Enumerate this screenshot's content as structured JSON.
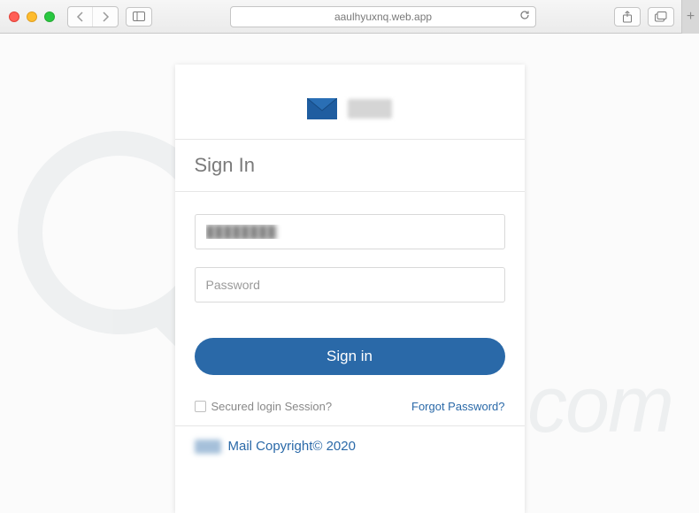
{
  "browser": {
    "url": "aaulhyuxnq.web.app"
  },
  "card": {
    "heading": "Sign In",
    "username_value": "████████",
    "password_placeholder": "Password",
    "signin_button": "Sign in",
    "secured_label": "Secured login Session?",
    "forgot_label": "Forgot Password?",
    "footer_text": "Mail Copyright© 2020"
  }
}
